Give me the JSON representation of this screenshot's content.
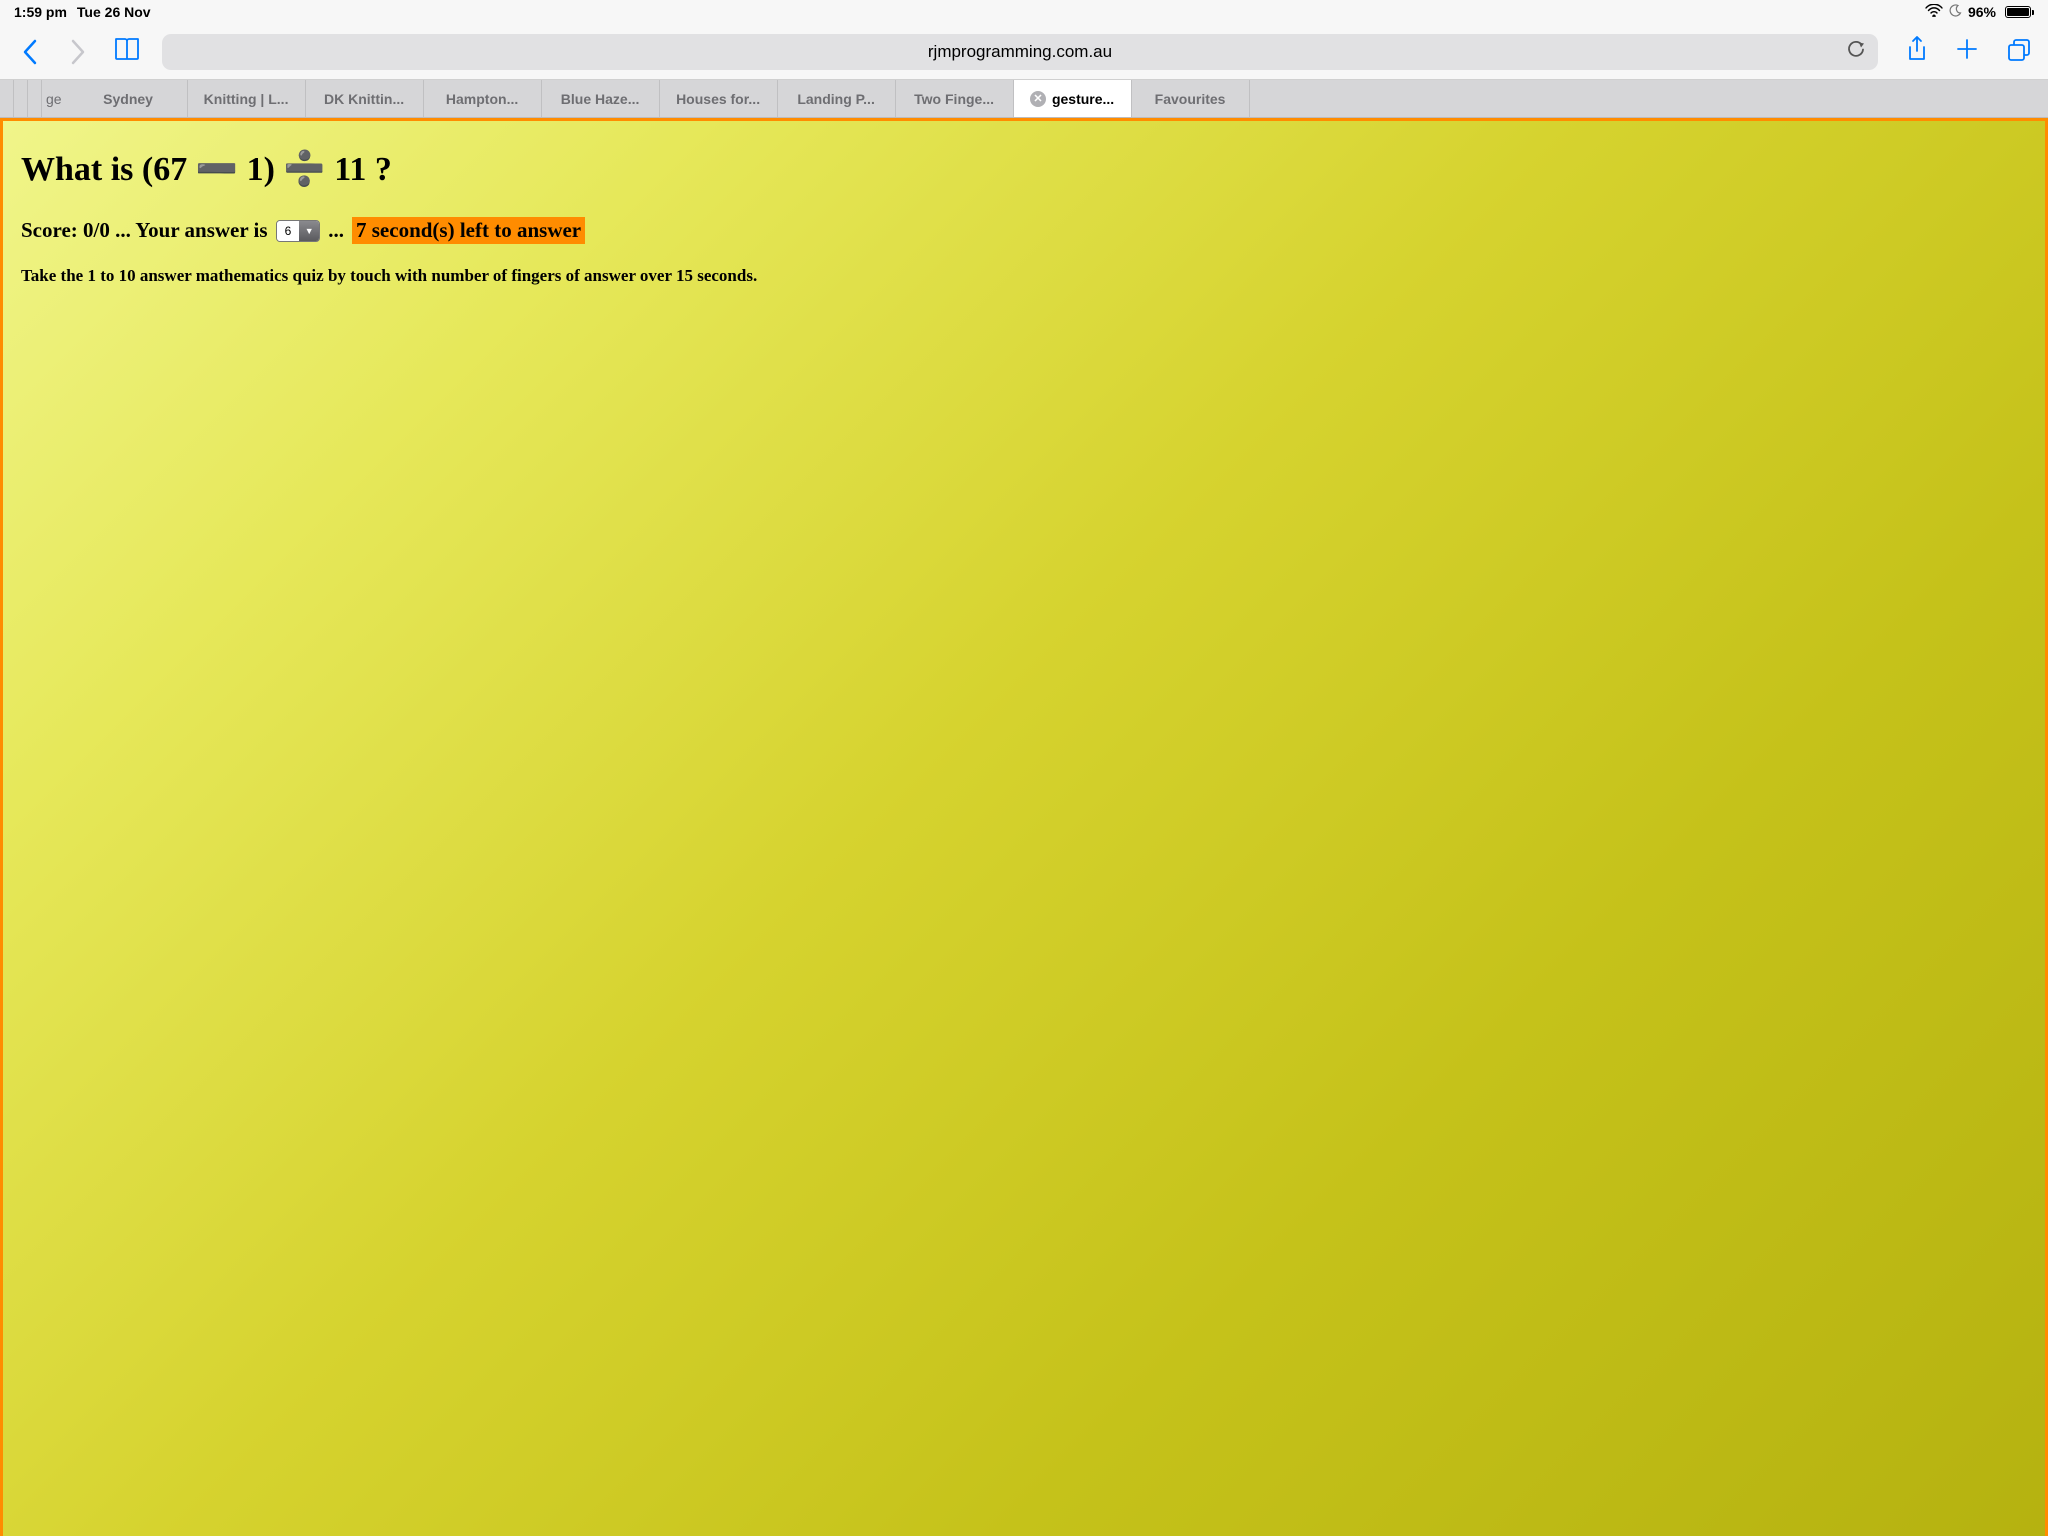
{
  "status": {
    "time": "1:59 pm",
    "date": "Tue 26 Nov",
    "battery_pct": "96%"
  },
  "toolbar": {
    "url": "rjmprogramming.com.au"
  },
  "tabs": {
    "prefix_partial": "ge",
    "items": [
      {
        "label": "Sydney"
      },
      {
        "label": "Knitting | L..."
      },
      {
        "label": "DK Knittin..."
      },
      {
        "label": "Hampton..."
      },
      {
        "label": "Blue Haze..."
      },
      {
        "label": "Houses for..."
      },
      {
        "label": "Landing P..."
      },
      {
        "label": "Two Finge..."
      },
      {
        "label": "gesture...",
        "active": true,
        "closeable": true
      },
      {
        "label": "Favourites"
      }
    ]
  },
  "quiz": {
    "question": "What is (67 ➖ 1) ➗ 11 ?",
    "score_prefix": "Score: 0/0 ... Your answer is",
    "selected_answer": "6",
    "ellipsis": "...",
    "countdown": "7 second(s) left to answer",
    "instructions": "Take the 1 to 10 answer mathematics quiz by touch with number of fingers of answer over 15 seconds."
  }
}
